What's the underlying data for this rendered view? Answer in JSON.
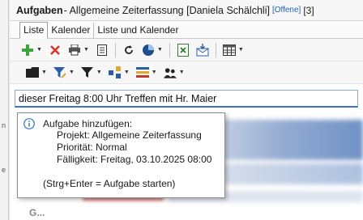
{
  "titlebar": {
    "app": "Aufgaben",
    "subtitle": " - Allgemeine Zeiterfassung [Daniela Schälchli]",
    "status_badge": "[Offene]",
    "count": "[3]"
  },
  "tabs": [
    {
      "label": "Liste",
      "active": true
    },
    {
      "label": "Kalender",
      "active": false
    },
    {
      "label": "Liste und Kalender",
      "active": false
    }
  ],
  "toolbar1": [
    "add-icon",
    "delete-icon",
    "print-icon",
    "notes-icon",
    "refresh-icon",
    "chart-icon",
    "excel-export-icon",
    "email-icon",
    "calendar-grid-icon"
  ],
  "toolbar2": [
    "folder-icon",
    "filter-edit-icon",
    "filter-icon",
    "grouping-icon",
    "color-list-icon",
    "users-icon"
  ],
  "quick_input": {
    "value": "dieser Freitag 8:00 Uhr Treffen mit Hr. Maier"
  },
  "tooltip": {
    "title": "Aufgabe hinzufügen:",
    "project": "Projekt: Allgemeine Zeiterfassung",
    "priority": "Priorität: Normal",
    "due": "Fälligkeit: Freitag, 03.10.2025 08:00",
    "hint": "(Strg+Enter = Aufgabe starten)"
  },
  "list": {
    "last_row_prefix": "G..."
  },
  "colors": {
    "accent": "#3b73c9",
    "badge": "#1f5fbf",
    "add_green": "#3aa53a",
    "delete_red": "#d9342b"
  }
}
